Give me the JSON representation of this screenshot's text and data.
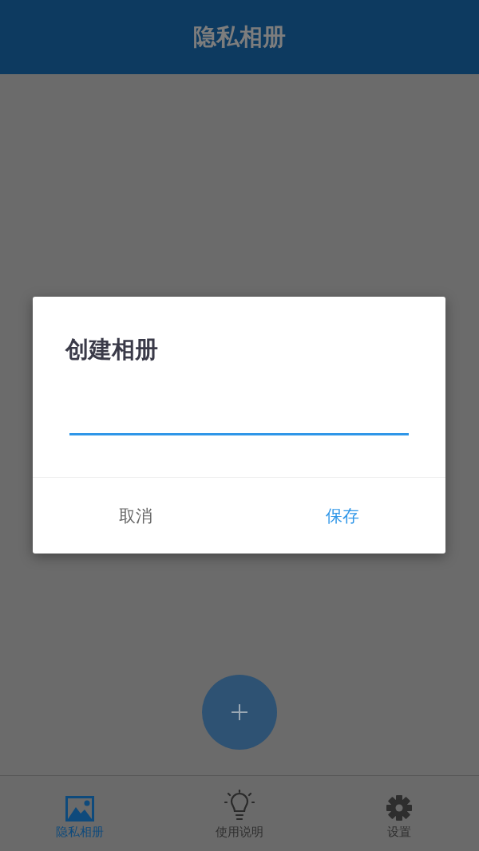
{
  "header": {
    "title": "隐私相册"
  },
  "dialog": {
    "title": "创建相册",
    "field": {
      "focused": true
    },
    "buttons": [
      {
        "label": "取消",
        "kind": "cancel"
      },
      {
        "label": "保存",
        "kind": "confirm"
      }
    ]
  },
  "fab": {
    "kind": "add"
  },
  "tabs": [
    {
      "label": "隐私相册",
      "kind": "picture",
      "selected": true
    },
    {
      "label": "使用说明",
      "kind": "bulb",
      "selected": false
    },
    {
      "label": "设置",
      "kind": "gear",
      "selected": false
    }
  ]
}
